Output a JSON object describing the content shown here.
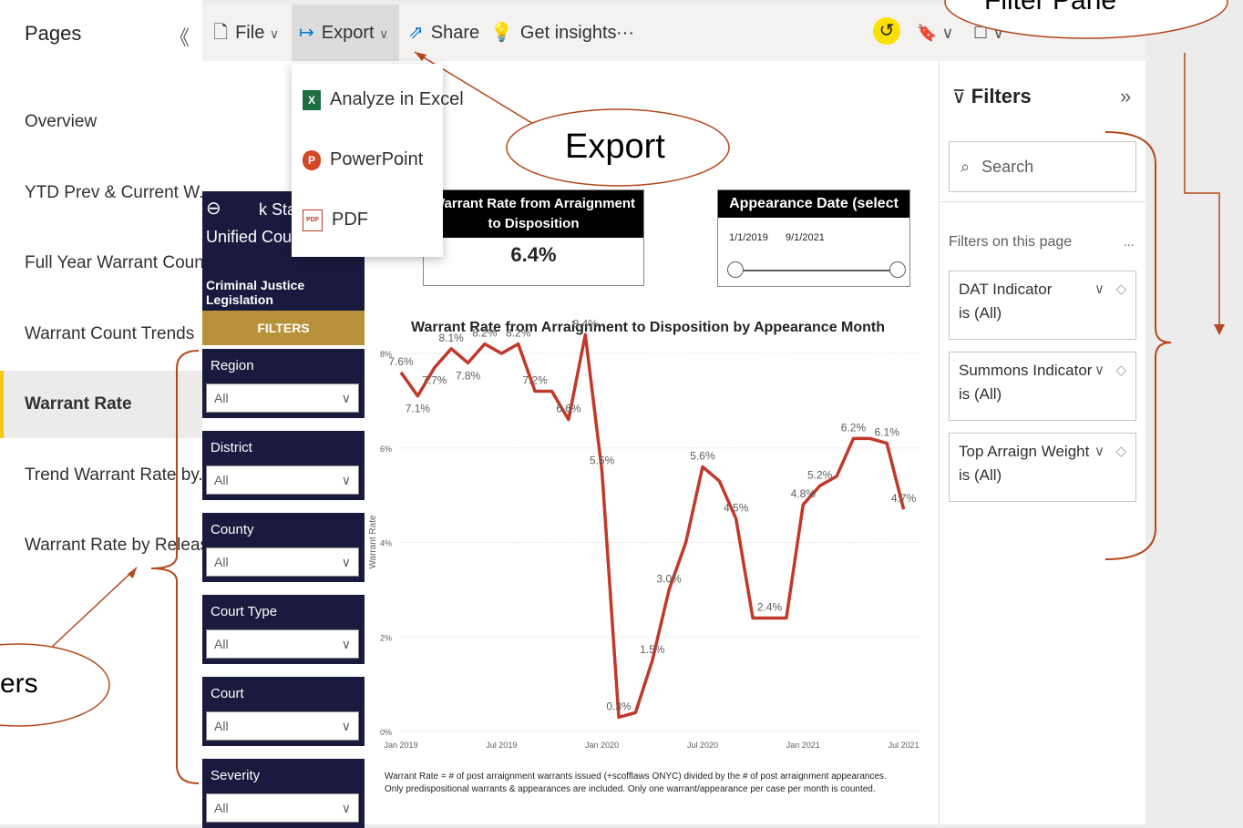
{
  "pages_pane": {
    "title": "Pages",
    "items": [
      {
        "label": "Overview",
        "active": false
      },
      {
        "label": "YTD Prev & Current W...",
        "active": false
      },
      {
        "label": "Full Year Warrant Count",
        "active": false
      },
      {
        "label": "Warrant Count Trends",
        "active": false
      },
      {
        "label": "Warrant Rate",
        "active": true
      },
      {
        "label": "Trend Warrant Rate by...",
        "active": false
      },
      {
        "label": "Warrant Rate by Releas...",
        "active": false
      }
    ]
  },
  "toolbar": {
    "file": "File",
    "export": "Export",
    "share": "Share",
    "insights": "Get insights",
    "more": "···"
  },
  "export_menu": {
    "items": [
      "Analyze in Excel",
      "PowerPoint",
      "PDF"
    ]
  },
  "report": {
    "header_text_1": "k Stat",
    "header_text_2": "Unified Court",
    "subtitle": "Criminal Justice Legislation",
    "filters_band": "FILTERS",
    "slicers": [
      {
        "label": "Region",
        "value": "All"
      },
      {
        "label": "District",
        "value": "All"
      },
      {
        "label": "County",
        "value": "All"
      },
      {
        "label": "Court Type",
        "value": "All"
      },
      {
        "label": "Court",
        "value": "All"
      },
      {
        "label": "Severity",
        "value": "All"
      }
    ],
    "kpi": {
      "title": "Warrant Rate from Arraignment to Disposition",
      "value": "6.4%"
    },
    "date_slicer": {
      "title": "Appearance Date (select dates)",
      "start": "1/1/2019",
      "end": "9/1/2021"
    },
    "footnote": "Warrant Rate = # of post arraignment warrants issued (+scofflaws ONYC) divided by the # of post arraignment appearances. Only predispositional warrants & appearances are included. Only one warrant/appearance per case per month is counted."
  },
  "chart_data": {
    "type": "line",
    "title": "Warrant Rate from Arraignment to Disposition by Appearance Month",
    "xlabel": "",
    "ylabel": "Warrant Rate",
    "ylim": [
      0,
      8
    ],
    "yticks": [
      "0%",
      "2%",
      "4%",
      "6%",
      "8%"
    ],
    "xticks": [
      "Jan 2019",
      "Jul 2019",
      "Jan 2020",
      "Jul 2020",
      "Jan 2021",
      "Jul 2021"
    ],
    "months_from_jan2019": [
      0,
      1,
      2,
      3,
      4,
      5,
      6,
      7,
      8,
      9,
      10,
      11,
      12,
      13,
      14,
      15,
      16,
      17,
      18,
      19,
      20,
      21,
      22,
      23,
      24,
      25,
      26,
      27,
      28,
      29,
      30,
      31
    ],
    "values": [
      7.6,
      7.1,
      7.7,
      8.1,
      7.8,
      8.2,
      8.0,
      8.2,
      7.2,
      7.2,
      6.6,
      8.4,
      5.5,
      0.3,
      0.4,
      1.5,
      3.0,
      4.0,
      5.6,
      5.3,
      4.5,
      2.4,
      2.4,
      2.4,
      4.8,
      5.2,
      5.4,
      6.2,
      6.2,
      6.1,
      4.7
    ],
    "data_labels": [
      {
        "i": 0,
        "text": "7.6%"
      },
      {
        "i": 1,
        "text": "7.1%"
      },
      {
        "i": 2,
        "text": "7.7%"
      },
      {
        "i": 3,
        "text": "8.1%"
      },
      {
        "i": 4,
        "text": "7.8%"
      },
      {
        "i": 5,
        "text": "8.2%"
      },
      {
        "i": 7,
        "text": "8.2%"
      },
      {
        "i": 8,
        "text": "7.2%"
      },
      {
        "i": 10,
        "text": "6.6%"
      },
      {
        "i": 11,
        "text": "8.4%"
      },
      {
        "i": 12,
        "text": "5.5%"
      },
      {
        "i": 13,
        "text": "0.3%"
      },
      {
        "i": 15,
        "text": "1.5%"
      },
      {
        "i": 16,
        "text": "3.0%"
      },
      {
        "i": 18,
        "text": "5.6%"
      },
      {
        "i": 20,
        "text": "4.5%"
      },
      {
        "i": 22,
        "text": "2.4%"
      },
      {
        "i": 24,
        "text": "4.8%"
      },
      {
        "i": 25,
        "text": "5.2%"
      },
      {
        "i": 27,
        "text": "6.2%"
      },
      {
        "i": 29,
        "text": "6.1%"
      },
      {
        "i": 30,
        "text": "4.7%"
      }
    ],
    "line_color": "#c0392b",
    "grid": true
  },
  "filter_pane": {
    "title": "Filters",
    "search_placeholder": "Search",
    "section": "Filters on this page",
    "section_more": "...",
    "cards": [
      {
        "name": "DAT Indicator",
        "state": "is (All)"
      },
      {
        "name": "Summons Indicator",
        "state": "is (All)"
      },
      {
        "name": "Top Arraign Weight",
        "state": "is (All)"
      }
    ]
  },
  "annotations": {
    "export_callout": "Export",
    "filter_pane_callout": "Filter Pane",
    "filters_callout": "ers"
  },
  "colors": {
    "slicer_bg": "#1a1a3f",
    "filters_band": "#b8923a",
    "accent_yellow": "#f2c811",
    "annotation": "#b5471b"
  }
}
